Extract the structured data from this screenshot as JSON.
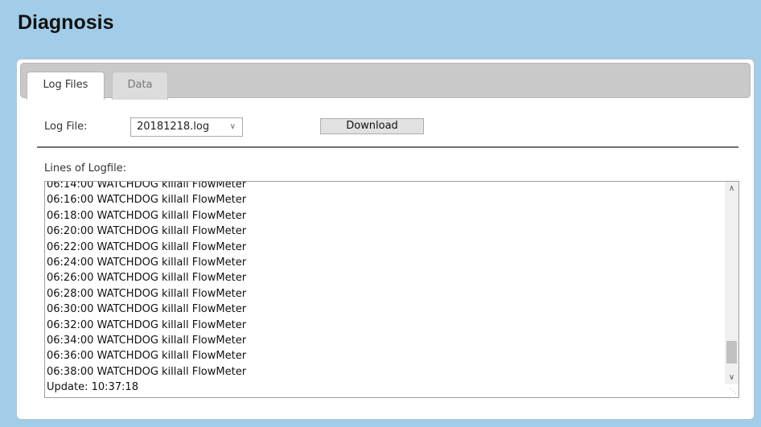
{
  "header": {
    "title": "Diagnosis"
  },
  "tabs": [
    {
      "label": "Log Files",
      "active": true
    },
    {
      "label": "Data",
      "active": false
    }
  ],
  "log_file": {
    "label": "Log File:",
    "selected": "20181218.log",
    "download_label": "Download"
  },
  "logfile_view": {
    "label": "Lines of Logfile:",
    "lines": [
      "06:14:00 WATCHDOG killall FlowMeter",
      "06:16:00 WATCHDOG killall FlowMeter",
      "06:18:00 WATCHDOG killall FlowMeter",
      "06:20:00 WATCHDOG killall FlowMeter",
      "06:22:00 WATCHDOG killall FlowMeter",
      "06:24:00 WATCHDOG killall FlowMeter",
      "06:26:00 WATCHDOG killall FlowMeter",
      "06:28:00 WATCHDOG killall FlowMeter",
      "06:30:00 WATCHDOG killall FlowMeter",
      "06:32:00 WATCHDOG killall FlowMeter",
      "06:34:00 WATCHDOG killall FlowMeter",
      "06:36:00 WATCHDOG killall FlowMeter",
      "06:38:00 WATCHDOG killall FlowMeter",
      "Update: 10:37:18"
    ]
  },
  "icons": {
    "select_chevron": "chevron-down-icon",
    "scroll_up": "chevron-up-icon",
    "scroll_down": "chevron-down-icon",
    "resize": "resize-grip-icon"
  }
}
